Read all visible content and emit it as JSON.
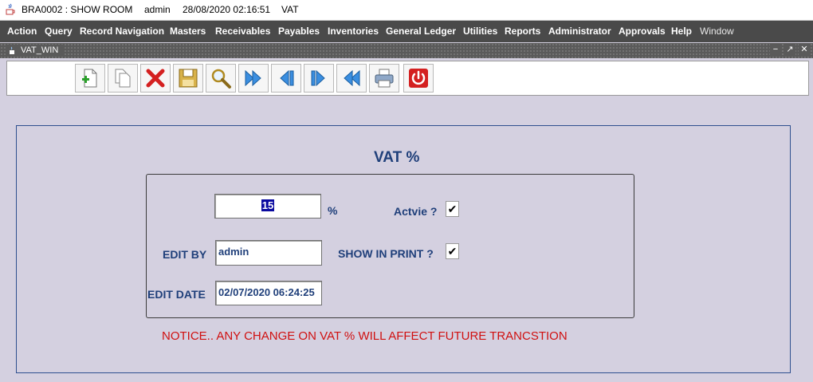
{
  "titlebar": {
    "branch": "BRA0002 : SHOW  ROOM",
    "user": "admin",
    "datetime": "28/08/2020 02:16:51",
    "module": "VAT",
    "icon": "java-cup-icon"
  },
  "menu": [
    "Action",
    "Query",
    "Record Navigation",
    "Masters",
    "Receivables",
    "Payables",
    "Inventories",
    "General Ledger",
    "Utilities",
    "Reports",
    "Administrator",
    "Approvals",
    "Help",
    "Window"
  ],
  "window": {
    "title": "VAT_WIN",
    "controls": [
      "minimize",
      "restore",
      "close"
    ]
  },
  "toolbar": [
    "new-record-icon",
    "copy-icon",
    "delete-icon",
    "save-icon",
    "search-icon",
    "next-set-icon",
    "previous-record-icon",
    "next-record-icon",
    "previous-set-icon",
    "print-icon",
    "exit-icon"
  ],
  "form": {
    "heading": "VAT %",
    "vat_value": "15",
    "percent_sign": "%",
    "active_label": "Actvie ?",
    "active_checked": true,
    "edit_by_label": "EDIT BY",
    "edit_by_value": "admin",
    "show_in_print_label": "SHOW IN PRINT ?",
    "show_in_print_checked": true,
    "edit_date_label": "EDIT DATE",
    "edit_date_value": "02/07/2020 06:24:25",
    "notice": "NOTICE.. ANY CHANGE ON VAT % WILL AFFECT FUTURE TRANCSTION"
  },
  "colors": {
    "label_blue": "#1f3f7a",
    "notice_red": "#d01010",
    "menu_bg": "#4a4a4a",
    "form_bg": "#d4d0e0"
  }
}
